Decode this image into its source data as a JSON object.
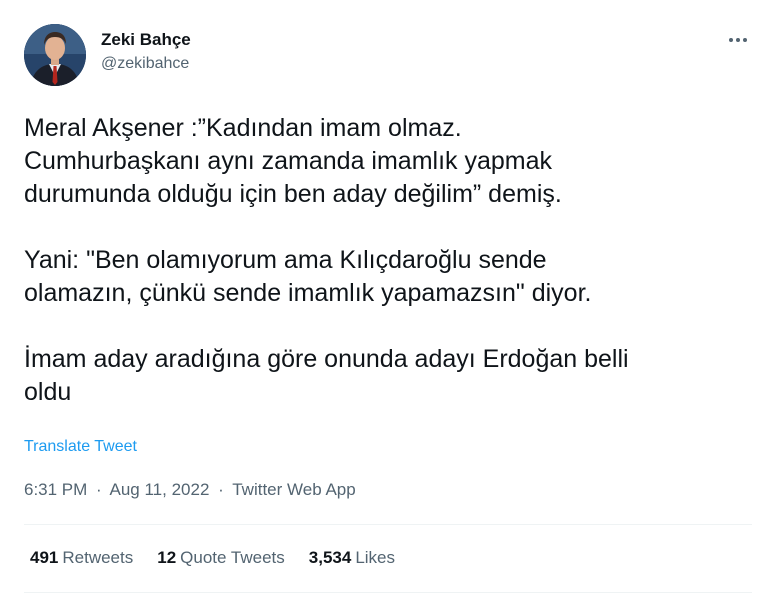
{
  "author": {
    "display_name": "Zeki Bahçe",
    "handle": "@zekibahce",
    "avatar_icon": "avatar"
  },
  "tweet": {
    "paragraphs": [
      "Meral Akşener :”Kadından imam olmaz.\nCumhurbaşkanı aynı zamanda imamlık yapmak\ndurumunda olduğu için ben aday değilim” demiş.",
      "Yani: \"Ben olamıyorum ama Kılıçdaroğlu sende\nolamazın, çünkü sende imamlık yapamazsın\" diyor.",
      "İmam aday aradığına göre onunda adayı Erdoğan belli\noldu"
    ],
    "translate_label": "Translate Tweet",
    "time": "6:31 PM",
    "date": "Aug 11, 2022",
    "source": "Twitter Web App",
    "separator": "·"
  },
  "stats": {
    "retweets": {
      "count": "491",
      "label": "Retweets"
    },
    "quotes": {
      "count": "12",
      "label": "Quote Tweets"
    },
    "likes": {
      "count": "3,534",
      "label": "Likes"
    }
  },
  "colors": {
    "link": "#1d9bf0",
    "secondary_text": "#536471",
    "primary_text": "#0f1419"
  }
}
